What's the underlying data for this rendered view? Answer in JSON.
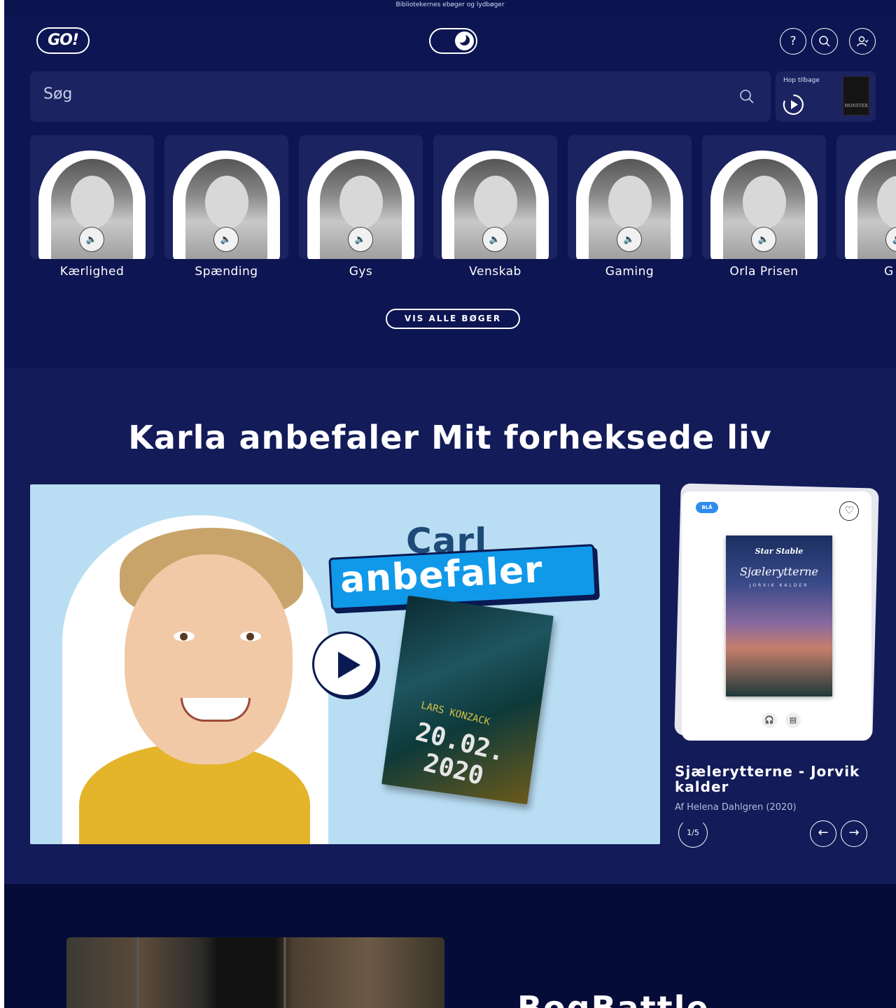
{
  "topbar": {
    "text": "Bibliotekernes ebøger og lydbøger"
  },
  "header": {
    "logo": "GO!",
    "theme_toggle": "dark",
    "icons": [
      "help-icon",
      "search-icon",
      "user-icon"
    ]
  },
  "search": {
    "placeholder": "Søg"
  },
  "resume": {
    "label": "Hop tilbage",
    "cover_title": "MONSTER"
  },
  "categories": [
    {
      "label": "Kærlighed"
    },
    {
      "label": "Spænding"
    },
    {
      "label": "Gys"
    },
    {
      "label": "Venskab"
    },
    {
      "label": "Gaming"
    },
    {
      "label": "Orla Prisen"
    },
    {
      "label": "G"
    }
  ],
  "show_all_button": "VIS ALLE BØGER",
  "recommendation": {
    "title": "Karla anbefaler Mit forheksede liv",
    "video": {
      "heading_name": "Carl",
      "heading_tag": "anbefaler",
      "book_author": "LARS KONZACK",
      "book_title_line1": "20.02.",
      "book_title_line2": "2020"
    },
    "book_card": {
      "badge": "BLÅ",
      "cover_brand": "Star Stable",
      "cover_title": "Sjælerytterne",
      "cover_subtitle": "JORVIK KALDER",
      "title": "Sjælerytterne - Jorvik kalder",
      "author": "Af Helena Dahlgren (2020)",
      "counter": "1/5"
    }
  },
  "battle": {
    "title": "BogBattle"
  },
  "colors": {
    "navy": "#0d1552",
    "accent_blue": "#1199e9",
    "sky": "#b9def4"
  }
}
